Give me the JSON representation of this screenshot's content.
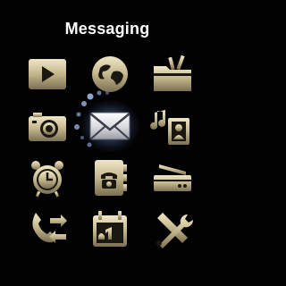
{
  "screen": {
    "title": "Messaging"
  },
  "menu": {
    "selected_index": 4,
    "items": [
      {
        "icon": "media-player-icon"
      },
      {
        "icon": "web-globe-icon"
      },
      {
        "icon": "file-folder-icon"
      },
      {
        "icon": "camera-icon"
      },
      {
        "icon": "envelope-icon"
      },
      {
        "icon": "music-contacts-icon"
      },
      {
        "icon": "alarm-clock-icon"
      },
      {
        "icon": "phonebook-icon"
      },
      {
        "icon": "scanner-icon"
      },
      {
        "icon": "call-transfer-icon"
      },
      {
        "icon": "calendar-icon"
      },
      {
        "icon": "settings-tools-icon"
      }
    ]
  },
  "colors": {
    "icon_gold": "#c9bd96",
    "icon_dark": "#6e6650",
    "background": "#020202",
    "highlight": "#a0beff"
  }
}
